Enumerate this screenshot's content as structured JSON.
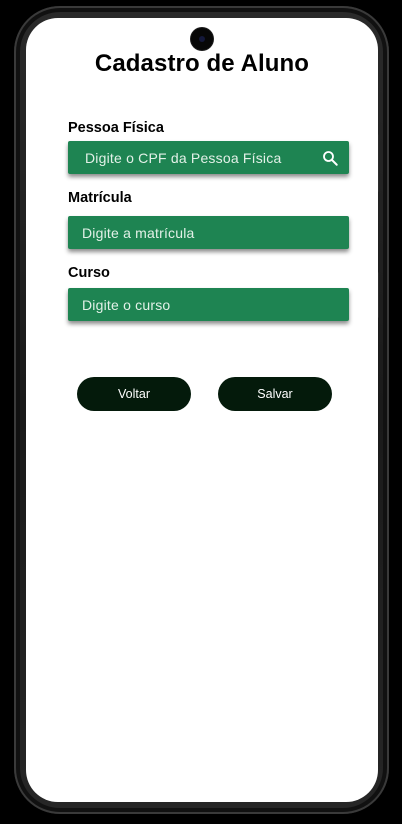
{
  "screen": {
    "title": "Cadastro de Aluno"
  },
  "form": {
    "pessoa_fisica": {
      "label": "Pessoa Física",
      "placeholder": "Digite o CPF da Pessoa Física",
      "icon": "search-icon"
    },
    "matricula": {
      "label": "Matrícula",
      "placeholder": "Digite a matrícula"
    },
    "curso": {
      "label": "Curso",
      "placeholder": "Digite o curso"
    }
  },
  "actions": {
    "back_label": "Voltar",
    "save_label": "Salvar"
  },
  "colors": {
    "field_background": "#1e8452",
    "button_background": "#041a0b",
    "screen_background": "#ffffff"
  }
}
